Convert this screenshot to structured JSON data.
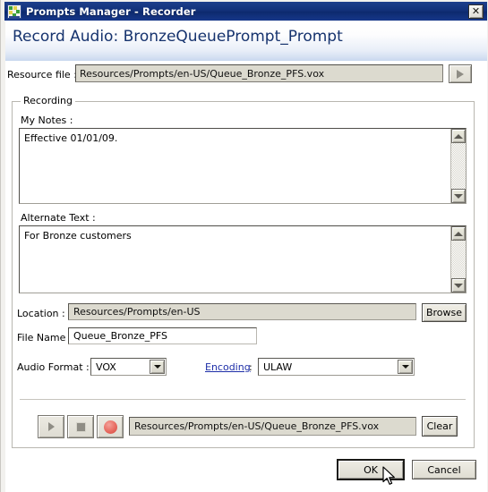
{
  "window": {
    "title": "Prompts Manager - Recorder",
    "icon": "prompts-manager-icon",
    "close_label": "✕"
  },
  "header": {
    "title": "Record Audio: BronzeQueuePrompt_Prompt"
  },
  "resource": {
    "label": "Resource file :",
    "value": "Resources/Prompts/en-US/Queue_Bronze_PFS.vox",
    "play_icon": "play-icon"
  },
  "recording": {
    "legend": "Recording",
    "notes": {
      "label": "My Notes :",
      "value": "Effective 01/01/09."
    },
    "alternate": {
      "label": "Alternate Text :",
      "value": "For Bronze customers"
    },
    "location": {
      "label": "Location :",
      "value": "Resources/Prompts/en-US",
      "browse_label": "Browse"
    },
    "filename": {
      "label": "File Name :",
      "value": "Queue_Bronze_PFS"
    },
    "audio_format": {
      "label": "Audio Format :",
      "value": "VOX",
      "options": [
        "VOX"
      ]
    },
    "encoding": {
      "link_label": "Encoding",
      "colon": ":",
      "value": "ULAW",
      "options": [
        "ULAW"
      ]
    },
    "player": {
      "play_icon": "play-icon",
      "stop_icon": "stop-icon",
      "record_icon": "record-icon",
      "path": "Resources/Prompts/en-US/Queue_Bronze_PFS.vox",
      "clear_label": "Clear"
    }
  },
  "footer": {
    "ok_label": "OK",
    "cancel_label": "Cancel"
  },
  "colors": {
    "titlebar": "#12317a",
    "header_accent": "#16336e",
    "link": "#1d2ea8",
    "record_red": "#ea746a",
    "field_readonly": "#dcdacf",
    "dialog_face": "#f2f1ee"
  },
  "scrollbars": {
    "up_icon": "chevron-up-icon",
    "down_icon": "chevron-down-icon"
  }
}
